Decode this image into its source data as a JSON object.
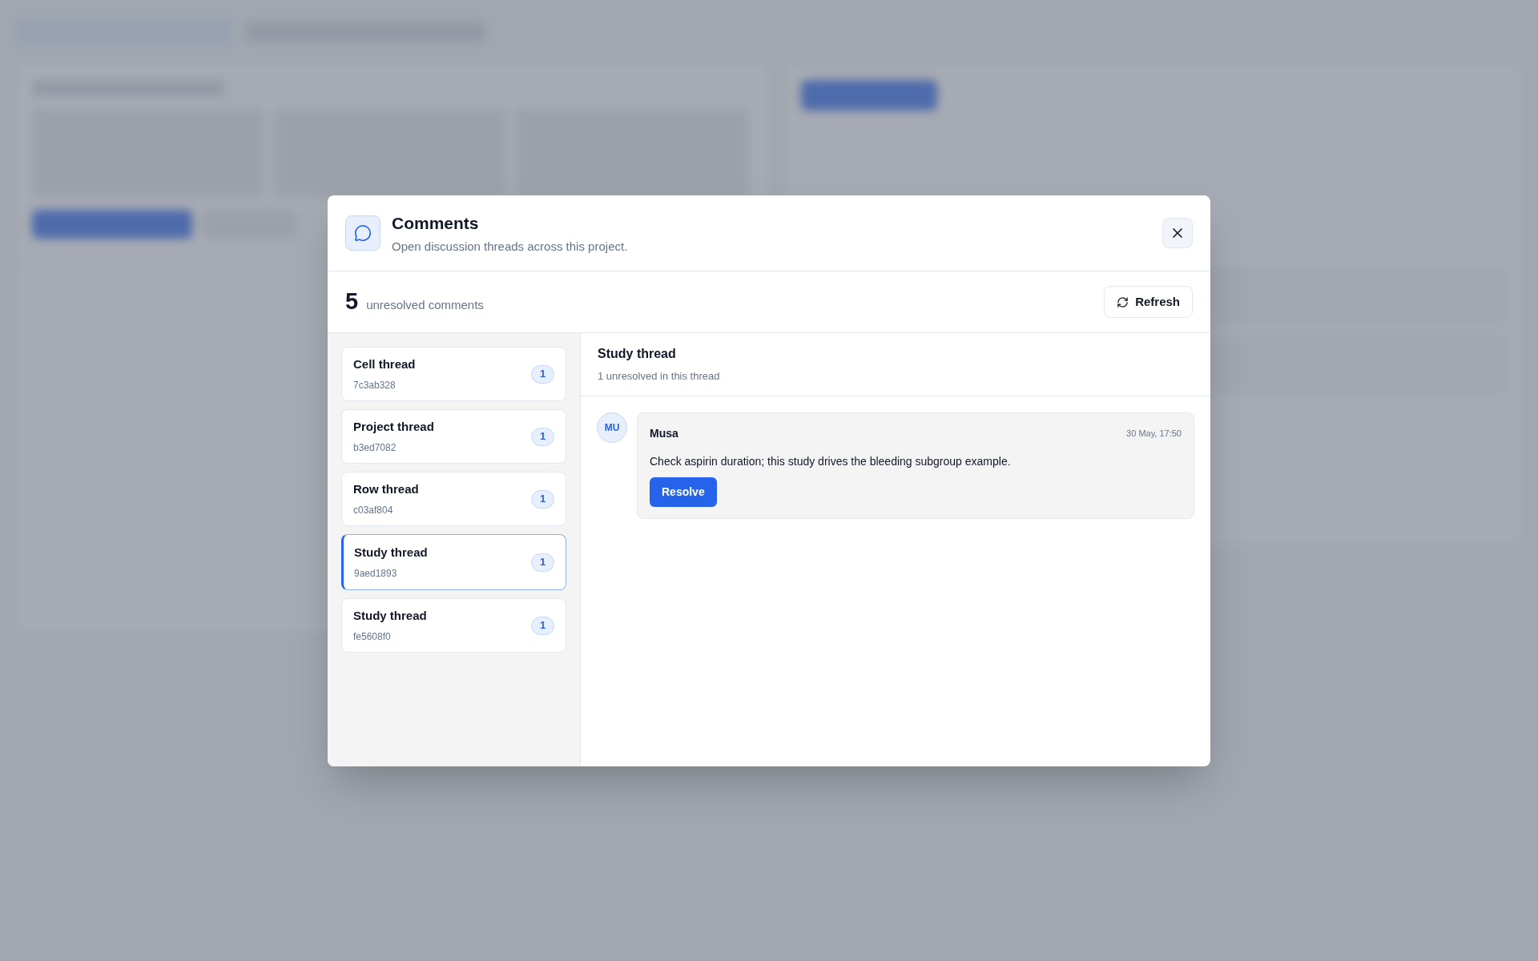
{
  "dialog": {
    "title": "Comments",
    "subtitle": "Open discussion threads across this project."
  },
  "summary": {
    "count": "5",
    "label": "unresolved comments",
    "refresh": "Refresh"
  },
  "threads": [
    {
      "title": "Cell thread",
      "id": "7c3ab328",
      "count": "1",
      "selected": false
    },
    {
      "title": "Project thread",
      "id": "b3ed7082",
      "count": "1",
      "selected": false
    },
    {
      "title": "Row thread",
      "id": "c03af804",
      "count": "1",
      "selected": false
    },
    {
      "title": "Study thread",
      "id": "9aed1893",
      "count": "1",
      "selected": true
    },
    {
      "title": "Study thread",
      "id": "fe5608f0",
      "count": "1",
      "selected": false
    }
  ],
  "detail": {
    "title": "Study thread",
    "subtitle": "1 unresolved in this thread",
    "comments": [
      {
        "initials": "MU",
        "author": "Musa",
        "time": "30 May, 17:50",
        "text": "Check aspirin duration; this study drives the bleeding subgroup example.",
        "action": "Resolve"
      }
    ]
  }
}
